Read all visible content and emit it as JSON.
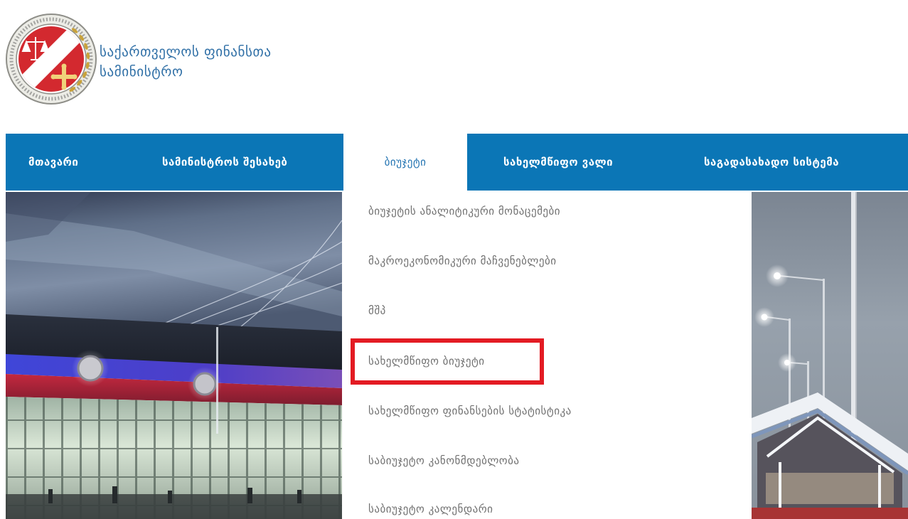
{
  "site": {
    "name_line1": "საქართველოს ფინანსთა",
    "name_line2": "სამინისტრო",
    "logo_icon": "ministry-seal-logo"
  },
  "nav": {
    "items": [
      {
        "label": "მთავარი",
        "active": false
      },
      {
        "label": "სამინისტროს შესახებ",
        "active": false
      },
      {
        "label": "ბიუჯეტი",
        "active": true
      },
      {
        "label": "სახელმწიფო ვალი",
        "active": false
      },
      {
        "label": "საგადასახადო სისტემა",
        "active": false
      }
    ]
  },
  "budget_menu": {
    "items": [
      {
        "label": "ბიუჯეტის ანალიტიკური მონაცემები"
      },
      {
        "label": "მაკროეკონომიკური მაჩვენებლები"
      },
      {
        "label": "მშპ"
      },
      {
        "label": "სახელმწიფო ბიუჯეტი",
        "highlighted": true
      },
      {
        "label": "სახელმწიფო ფინანსების სტატისტიკა"
      },
      {
        "label": "საბიუჯეტო კანონმდებლობა"
      },
      {
        "label": "საბიუჯეტო კალენდარი"
      }
    ]
  },
  "colors": {
    "nav_bg": "#0b76b6",
    "nav_text": "#ffffff",
    "active_text": "#2374b2",
    "menu_text": "#707070",
    "brand_text": "#2f6fa6",
    "highlight": "#e31b23"
  }
}
